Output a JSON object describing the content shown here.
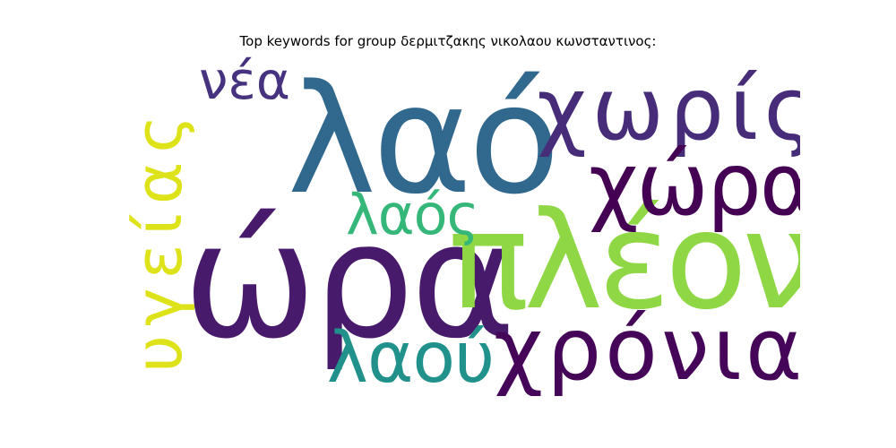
{
  "title": "Top keywords for group δερμιτζακης νικολαου κωνσταντινος:",
  "words": [
    {
      "text": "λαό",
      "color": "#31688e"
    },
    {
      "text": "ώρα",
      "color": "#481a6c"
    },
    {
      "text": "πλέον",
      "color": "#8fd744"
    },
    {
      "text": "χωρίς",
      "color": "#472c7a"
    },
    {
      "text": "χώρα",
      "color": "#440154"
    },
    {
      "text": "χρόνια",
      "color": "#450559"
    },
    {
      "text": "υγείας",
      "color": "#dde318"
    },
    {
      "text": "νέα",
      "color": "#46327e"
    },
    {
      "text": "λαός",
      "color": "#35b779"
    },
    {
      "text": "λαού",
      "color": "#21918c"
    }
  ]
}
